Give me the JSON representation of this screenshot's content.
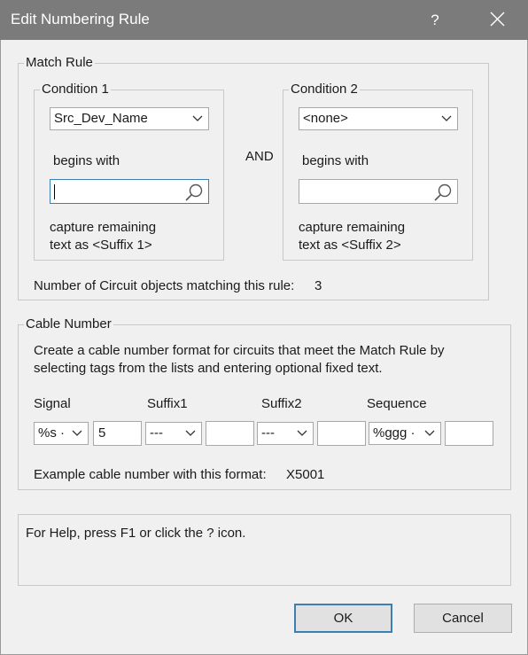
{
  "titlebar": {
    "title": "Edit Numbering Rule",
    "help_glyph": "?",
    "close_icon": "close-icon"
  },
  "match_rule": {
    "legend": "Match Rule",
    "condition1": {
      "legend": "Condition 1",
      "field_value": "Src_Dev_Name",
      "begins_with_label": "begins with",
      "search_value": "",
      "capture_line1": "capture remaining",
      "capture_line2": "text as <Suffix 1>"
    },
    "and_label": "AND",
    "condition2": {
      "legend": "Condition 2",
      "field_value": "<none>",
      "begins_with_label": "begins with",
      "search_value": "",
      "capture_line1": "capture remaining",
      "capture_line2": "text as <Suffix 2>"
    },
    "count_label": "Number of Circuit objects matching this rule:",
    "count_value": "3"
  },
  "cable_number": {
    "legend": "Cable Number",
    "description_line1": "Create a cable number format for circuits that meet the Match Rule by",
    "description_line2": "selecting tags from the lists and entering optional fixed text.",
    "signal_label": "Signal",
    "signal_value": "%s ·",
    "signal_text": "5",
    "suffix1_label": "Suffix1",
    "suffix1_value": "---",
    "suffix1_text": "",
    "suffix2_label": "Suffix2",
    "suffix2_value": "---",
    "suffix2_text": "",
    "sequence_label": "Sequence",
    "sequence_value": "%ggg ·",
    "sequence_text": "",
    "example_label": "Example cable number with this format:",
    "example_value": "X5001"
  },
  "help_box": {
    "text": "For Help, press F1 or click the ? icon."
  },
  "buttons": {
    "ok": "OK",
    "cancel": "Cancel"
  },
  "colors": {
    "titlebar": "#7b7b7b",
    "dialog_bg": "#f0f0f0",
    "focus_border": "#3c7fb1"
  }
}
